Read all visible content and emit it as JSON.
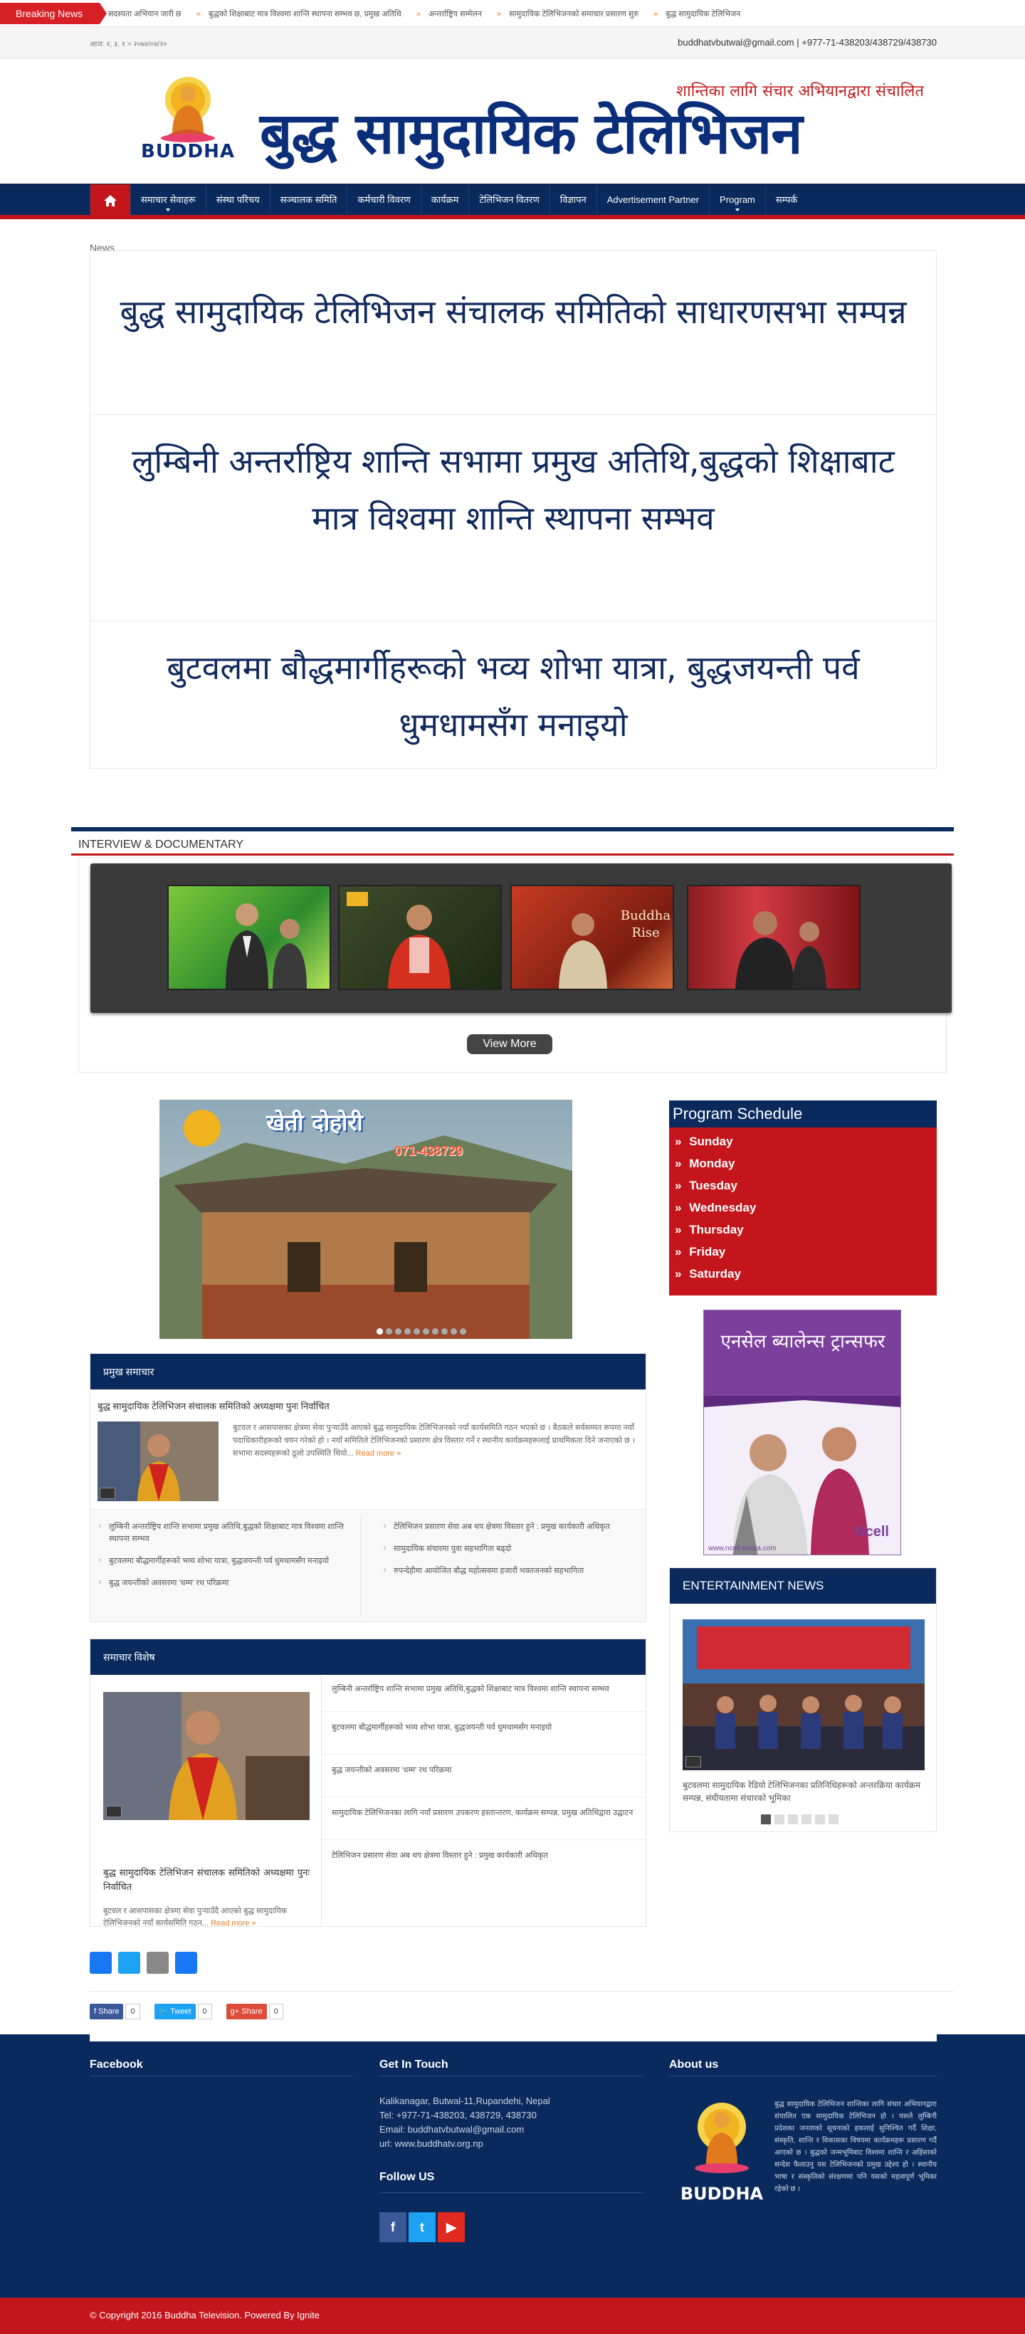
{
  "breaking": {
    "label": "Breaking News",
    "items": [
      "सदस्यता अभियान जारी छ",
      "बुद्धको शिक्षाबाट मात्र विश्वमा शान्ति स्थापना सम्भव छ, प्रमुख अतिथि",
      "अन्तर्राष्ट्रिय सम्मेलन",
      "सामुदायिक टेलिभिजनको समाचार प्रसारण सुरु",
      "बुद्ध सामुदायिक टेलिभिजन"
    ]
  },
  "topstrip": {
    "date": "आज: २, ३, १ > २०७४/०४/२०",
    "contact": "buddhatvbutwal@gmail.com | +977-71-438203/438729/438730"
  },
  "header": {
    "logo_text": "BUDDHA",
    "title": "बुद्ध सामुदायिक टेलिभिजन",
    "tagline": "शान्तिका लागि संचार अभियानद्वारा संचालित"
  },
  "nav": {
    "items": [
      {
        "label": "समाचार सेवाहरू",
        "sub": true
      },
      {
        "label": "संस्था परिचय",
        "sub": false
      },
      {
        "label": "सञ्चालक समिति",
        "sub": false
      },
      {
        "label": "कर्मचारी विवरण",
        "sub": false
      },
      {
        "label": "कार्यक्रम",
        "sub": false
      },
      {
        "label": "टेलिभिजन वितरण",
        "sub": false
      },
      {
        "label": "विज्ञापन",
        "sub": false
      },
      {
        "label": "Advertisement Partner",
        "sub": false
      },
      {
        "label": "Program",
        "sub": true
      },
      {
        "label": "सम्पर्क",
        "sub": false
      }
    ]
  },
  "headlines": {
    "small_label": "News",
    "items": [
      "बुद्ध सामुदायिक टेलिभिजन संचालक समितिको साधारणसभा सम्पन्न",
      "लुम्बिनी अन्तर्राष्ट्रिय शान्ति सभामा प्रमुख अतिथि,बुद्धको शिक्षाबाट मात्र विश्वमा शान्ति स्थापना सम्भव",
      "बुटवलमा बौद्धमार्गीहरूको भव्य शोभा यात्रा, बुद्धजयन्ती पर्व धुमधामसँग मनाइयो"
    ]
  },
  "interview": {
    "title": "INTERVIEW & DOCUMENTARY",
    "thumb_texts": [
      "",
      "",
      "Buddha Rise",
      ""
    ],
    "view_more": "View More"
  },
  "slider": {
    "overlay_title": "खेती दोहोरी",
    "overlay_phone": "071-438729"
  },
  "schedule": {
    "title": "Program Schedule",
    "days": [
      "Sunday",
      "Monday",
      "Tuesday",
      "Wednesday",
      "Thursday",
      "Friday",
      "Saturday"
    ]
  },
  "ad": {
    "headline": "एनसेल ब्यालेन्स ट्रान्सफर",
    "brand": "Ncell",
    "url": "www.ncell.axiata.com"
  },
  "entertainment": {
    "title": "ENTERTAINMENT NEWS",
    "caption": "बुटवलमा सामुदायिक रेडियो टेलिभिजनका प्रतिनिधिहरूको अन्तरक्रिया कार्यक्रम सम्पन्न, संघीयतामा संचारको भूमिका"
  },
  "block1": {
    "title": "प्रमुख समाचार",
    "lead": "बुद्ध सामुदायिक टेलिभिजन संचालक समितिको अध्यक्षमा पुनः निर्वाचित",
    "excerpt": "बुटवल र आसपासका क्षेत्रमा सेवा पुर्‍याउँदै आएको बुद्ध सामुदायिक टेलिभिजनको नयाँ कार्यसमिति गठन भएको छ । बैठकले सर्वसम्मत रूपमा नयाँ पदाधिकारीहरूको चयन गरेको हो । नयाँ समितिले टेलिभिजनको प्रसारण क्षेत्र विस्तार गर्ने र स्थानीय कार्यक्रमहरूलाई प्राथमिकता दिने जनाएको छ । सभामा सदस्यहरूको ठूलो उपस्थिति थियो...",
    "more": "Read more »",
    "list_left": [
      "लुम्बिनी अन्तर्राष्ट्रिय शान्ति सभामा प्रमुख अतिथि,बुद्धको शिक्षाबाट मात्र विश्वमा शान्ति स्थापना सम्भव",
      "बुटवलमा बौद्धमार्गीहरूको भव्य शोभा यात्रा, बुद्धजयन्ती पर्व धुमधामसँग मनाइयो",
      "बुद्ध जयन्तीको अवसरमा 'धम्म' रथ परिक्रमा"
    ],
    "list_right": [
      "टेलिभिजन प्रसारण सेवा अब थप क्षेत्रमा विस्तार हुने : प्रमुख कार्यकारी अधिकृत",
      "सामुदायिक संचारमा युवा सहभागिता बढ्दो",
      "रुपन्देहीमा आयोजित बौद्ध महोत्सवमा हजारौं भक्तजनको सहभागिता"
    ]
  },
  "block2": {
    "title": "समाचार विशेष",
    "lead_title": "बुद्ध सामुदायिक टेलिभिजन संचालक समितिको अध्यक्षमा पुनः निर्वाचित",
    "excerpt": "बुटवल र आसपासका क्षेत्रमा सेवा पुर्‍याउँदै आएको बुद्ध सामुदायिक टेलिभिजनको नयाँ कार्यसमिति गठन...",
    "more": "Read more »",
    "list": [
      "लुम्बिनी अन्तर्राष्ट्रिय शान्ति सभामा प्रमुख अतिथि,बुद्धको शिक्षाबाट मात्र विश्वमा शान्ति स्थापना सम्भव",
      "बुटवलमा बौद्धमार्गीहरूको भव्य शोभा यात्रा, बुद्धजयन्ती पर्व धुमधामसँग मनाइयो",
      "बुद्ध जयन्तीको अवसरमा 'धम्म' रथ परिक्रमा",
      "सामुदायिक टेलिभिजनका लागि नयाँ प्रसारण उपकरण हस्तान्तरण, कार्यक्रम सम्पन्न, प्रमुख अतिथिद्वारा उद्घाटन",
      "टेलिभिजन प्रसारण सेवा अब थप क्षेत्रमा विस्तार हुने : प्रमुख कार्यकारी अधिकृत"
    ]
  },
  "share": {
    "fb_label": "Share",
    "fb_count": "0",
    "tw_label": "Tweet",
    "tw_count": "0",
    "gp_label": "Share",
    "gp_count": "0"
  },
  "footer": {
    "facebook_title": "Facebook",
    "contact_title": "Get In Touch",
    "address": "Kalikanagar, Butwal-11,Rupandehi, Nepal",
    "tel": "Tel: +977-71-438203, 438729, 438730",
    "email": "Email: buddhatvbutwal@gmail.com",
    "url": "url: www.buddhatv.org.np",
    "follow_title": "Follow US",
    "about_title": "About us",
    "about_text": "बुद्ध सामुदायिक टेलिभिजन शान्तिका लागि संचार अभियानद्वारा संचालित एक सामुदायिक टेलिभिजन हो । यसले लुम्बिनी प्रदेशका जनताको सूचनाको हकलाई सुनिश्चित गर्दै शिक्षा, संस्कृति, शान्ति र विकासका विषयमा कार्यक्रमहरू प्रसारण गर्दै आएको छ । बुद्धको जन्मभूमिबाट विश्वमा शान्ति र अहिंसाको सन्देश फैलाउनु यस टेलिभिजनको प्रमुख उद्देश्य हो । स्थानीय भाषा र संस्कृतिको संरक्षणमा पनि यसको महत्वपूर्ण भूमिका रहेको छ ।",
    "about_logo": "BUDDHA",
    "copyright": "© Copyright 2016 Buddha Television. Powered By Ignite"
  },
  "colors": {
    "navy": "#0a2a5e",
    "red": "#c3151b",
    "accent_orange": "#e67e22"
  }
}
